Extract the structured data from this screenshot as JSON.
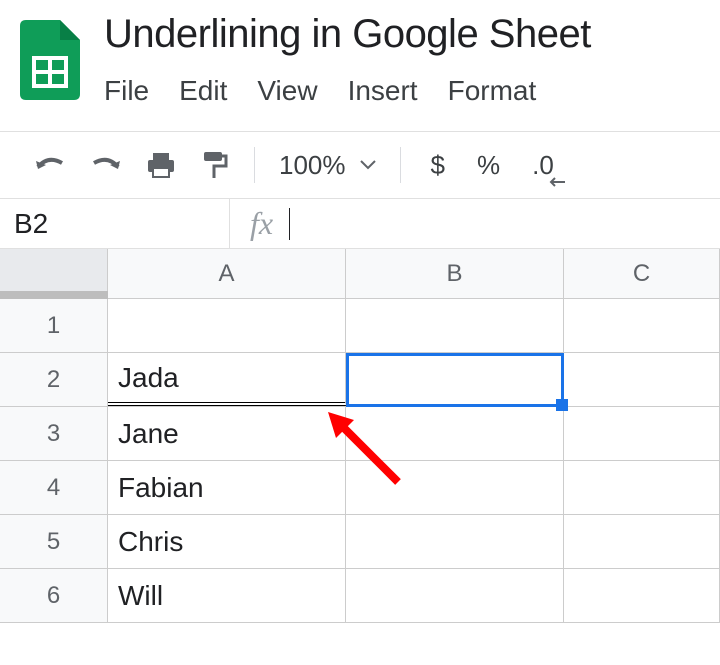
{
  "doc_title": "Underlining in Google Sheet",
  "menu": {
    "file": "File",
    "edit": "Edit",
    "view": "View",
    "insert": "Insert",
    "format": "Format"
  },
  "toolbar": {
    "zoom": "100%",
    "currency": "$",
    "percent": "%",
    "decimal": ".0"
  },
  "name_box": "B2",
  "fx_label": "fx",
  "columns": {
    "A": "A",
    "B": "B",
    "C": "C"
  },
  "rows": {
    "1": {
      "num": "1",
      "A": "",
      "B": "",
      "C": ""
    },
    "2": {
      "num": "2",
      "A": "Jada",
      "B": "",
      "C": ""
    },
    "3": {
      "num": "3",
      "A": "Jane",
      "B": "",
      "C": ""
    },
    "4": {
      "num": "4",
      "A": "Fabian",
      "B": "",
      "C": ""
    },
    "5": {
      "num": "5",
      "A": "Chris",
      "B": "",
      "C": ""
    },
    "6": {
      "num": "6",
      "A": "Will",
      "B": "",
      "C": ""
    }
  },
  "selected_cell": "B2"
}
